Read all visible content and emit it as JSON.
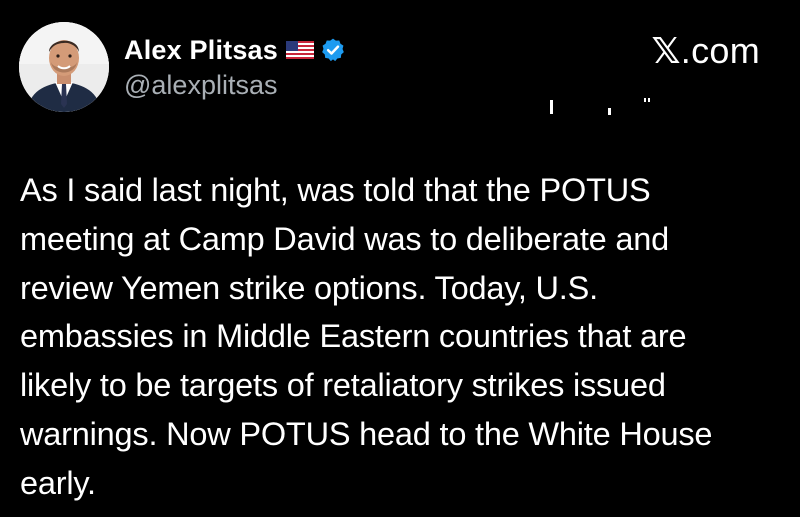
{
  "author": {
    "display_name": "Alex Plitsas",
    "handle": "@alexplitsas",
    "avatar_icon": "avatar-photo",
    "flag_icon": "us-flag-icon",
    "verified_icon": "verified-badge-icon",
    "verified_color": "#1d9bf0"
  },
  "brand": {
    "text": ".com",
    "logo_glyph": "𝕏"
  },
  "tweet": {
    "text": "As I said last night, was told that the POTUS\nmeeting at Camp David was to deliberate and\nreview Yemen strike options. Today, U.S.\nembassies in Middle Eastern countries that are\nlikely to be targets of retaliatory strikes issued\nwarnings. Now POTUS head to the White House\nearly."
  },
  "colors": {
    "background": "#000000",
    "text": "#ffffff",
    "secondary_text": "#a9afb5"
  }
}
